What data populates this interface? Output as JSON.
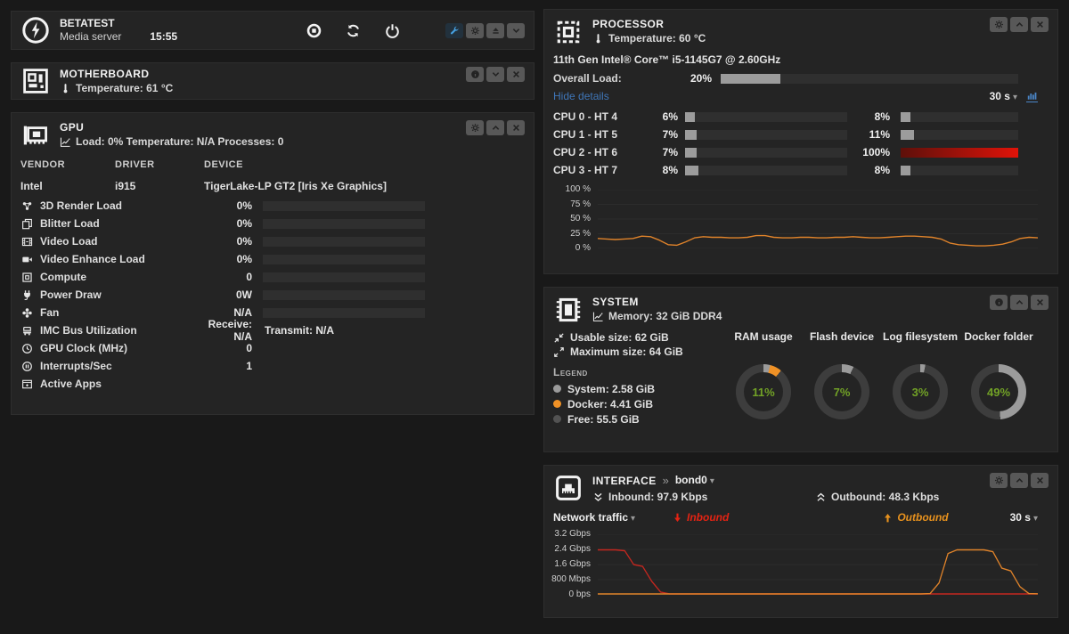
{
  "server": {
    "name": "BETATEST",
    "description": "Media server",
    "time": "15:55",
    "action_icons": [
      "stop-icon",
      "refresh-icon",
      "power-icon"
    ],
    "corner_icons": [
      "wrench-icon",
      "gear-icon",
      "eject-icon",
      "chevron-down-icon"
    ]
  },
  "motherboard": {
    "title": "MOTHERBOARD",
    "temperature": "Temperature: 61 °C",
    "buttons": [
      "info-icon",
      "chevron-down-icon",
      "close-icon"
    ]
  },
  "gpu": {
    "title": "GPU",
    "stats": "Load: 0% Temperature: N/A Processes: 0",
    "buttons": [
      "gear-icon",
      "chevron-up-icon",
      "close-icon"
    ],
    "columns": [
      "VENDOR",
      "DRIVER",
      "DEVICE"
    ],
    "vendor": "Intel",
    "driver": "i915",
    "device": "TigerLake-LP GT2 [Iris Xe Graphics]",
    "metrics": [
      {
        "icon": "render-3d-icon",
        "label": "3D Render Load",
        "value": "0%",
        "bar": 0
      },
      {
        "icon": "blitter-icon",
        "label": "Blitter Load",
        "value": "0%",
        "bar": 0
      },
      {
        "icon": "video-icon",
        "label": "Video Load",
        "value": "0%",
        "bar": 0
      },
      {
        "icon": "video-enhance-icon",
        "label": "Video Enhance Load",
        "value": "0%",
        "bar": 0
      },
      {
        "icon": "compute-icon",
        "label": "Compute",
        "value": "0",
        "bar": 0
      },
      {
        "icon": "power-draw-icon",
        "label": "Power Draw",
        "value": "0W",
        "bar": 0
      },
      {
        "icon": "fan-icon",
        "label": "Fan",
        "value": "N/A",
        "bar": 0
      },
      {
        "icon": "bus-icon",
        "label": "IMC Bus Utilization",
        "value": "Receive: N/A",
        "value2": "Transmit: N/A"
      },
      {
        "icon": "clock-icon",
        "label": "GPU Clock (MHz)",
        "value": "0"
      },
      {
        "icon": "interrupts-icon",
        "label": "Interrupts/Sec",
        "value": "1"
      },
      {
        "icon": "active-apps-icon",
        "label": "Active Apps",
        "value": ""
      }
    ]
  },
  "processor": {
    "title": "PROCESSOR",
    "temperature": "Temperature: 60 °C",
    "buttons": [
      "gear-icon",
      "chevron-up-icon",
      "close-icon"
    ],
    "model": "11th Gen Intel® Core™ i5-1145G7 @ 2.60GHz",
    "overall_label": "Overall Load:",
    "overall_value": "20%",
    "overall_pct": 20,
    "hide_details": "Hide details",
    "interval": "30 s",
    "cores": [
      {
        "label": "CPU 0 - HT 4",
        "v1": "6%",
        "p1": 6,
        "v2": "8%",
        "p2": 8
      },
      {
        "label": "CPU 1 - HT 5",
        "v1": "7%",
        "p1": 7,
        "v2": "11%",
        "p2": 11
      },
      {
        "label": "CPU 2 - HT 6",
        "v1": "7%",
        "p1": 7,
        "v2": "100%",
        "p2": 100,
        "alert": true
      },
      {
        "label": "CPU 3 - HT 7",
        "v1": "8%",
        "p1": 8,
        "v2": "8%",
        "p2": 8
      }
    ],
    "chart": {
      "type": "line",
      "ymax": 100,
      "ticks": [
        "100 %",
        "75 %",
        "50 %",
        "25 %",
        "0 %"
      ],
      "series": [
        {
          "name": "CPU load",
          "color": "#e0832a",
          "values": [
            16,
            15,
            14,
            15,
            16,
            20,
            19,
            13,
            5,
            4,
            10,
            17,
            19,
            18,
            18,
            17,
            17,
            18,
            21,
            21,
            18,
            17,
            17,
            18,
            18,
            17,
            17,
            18,
            18,
            19,
            18,
            17,
            17,
            18,
            19,
            20,
            20,
            19,
            18,
            15,
            8,
            5,
            4,
            3,
            3,
            4,
            6,
            10,
            16,
            18,
            17
          ]
        }
      ]
    }
  },
  "system": {
    "title": "SYSTEM",
    "memory": "Memory: 32 GiB DDR4",
    "buttons": [
      "info-icon",
      "chevron-up-icon",
      "close-icon"
    ],
    "usable": "Usable size: 62 GiB",
    "maximum": "Maximum size: 64 GiB",
    "legend_title": "Legend",
    "legend": [
      {
        "color": "#9b9b9b",
        "label": "System: 2.58 GiB"
      },
      {
        "color": "#ef9126",
        "label": "Docker: 4.41 GiB"
      },
      {
        "color": "#525252",
        "label": "Free: 55.5 GiB"
      }
    ],
    "donut_base": "#3d3d3d",
    "donuts": [
      {
        "title": "RAM usage",
        "pct": "11%",
        "segments": [
          {
            "color": "#9b9b9b",
            "value": 4
          },
          {
            "color": "#ef9126",
            "value": 7
          }
        ]
      },
      {
        "title": "Flash device",
        "pct": "7%",
        "segments": [
          {
            "color": "#9b9b9b",
            "value": 7
          }
        ]
      },
      {
        "title": "Log filesystem",
        "pct": "3%",
        "segments": [
          {
            "color": "#9b9b9b",
            "value": 3
          }
        ]
      },
      {
        "title": "Docker folder",
        "pct": "49%",
        "segments": [
          {
            "color": "#9b9b9b",
            "value": 49
          }
        ]
      }
    ]
  },
  "interface": {
    "title": "INTERFACE",
    "separator": "»",
    "port": "bond0",
    "buttons": [
      "gear-icon",
      "chevron-up-icon",
      "close-icon"
    ],
    "inbound": "Inbound: 97.9 Kbps",
    "outbound": "Outbound: 48.3 Kbps",
    "traffic_label": "Network traffic",
    "inbound_legend": "Inbound",
    "outbound_legend": "Outbound",
    "interval": "30 s",
    "chart": {
      "type": "line",
      "ymax": 3.2,
      "ticks": [
        "3.2 Gbps",
        "2.4 Gbps",
        "1.6 Gbps",
        "800 Mbps",
        "0 bps"
      ],
      "series": [
        {
          "name": "Inbound",
          "color": "#c5271f",
          "values": [
            2.4,
            2.4,
            2.4,
            2.35,
            1.6,
            1.5,
            0.7,
            0.1,
            0,
            0,
            0,
            0,
            0,
            0,
            0,
            0,
            0,
            0,
            0,
            0,
            0,
            0,
            0,
            0,
            0,
            0,
            0,
            0,
            0,
            0,
            0,
            0,
            0,
            0,
            0,
            0,
            0,
            0,
            0,
            0,
            0,
            0,
            0,
            0,
            0,
            0,
            0,
            0,
            0,
            0
          ]
        },
        {
          "name": "Outbound",
          "color": "#e0832a",
          "values": [
            0,
            0,
            0,
            0,
            0,
            0,
            0,
            0,
            0,
            0,
            0,
            0,
            0,
            0,
            0,
            0,
            0,
            0,
            0,
            0,
            0,
            0,
            0,
            0,
            0,
            0,
            0,
            0,
            0,
            0,
            0,
            0,
            0,
            0,
            0,
            0,
            0,
            0.02,
            0.6,
            2.2,
            2.4,
            2.4,
            2.4,
            2.4,
            2.3,
            1.4,
            1.25,
            0.4,
            0.02,
            0.01
          ]
        }
      ]
    }
  }
}
